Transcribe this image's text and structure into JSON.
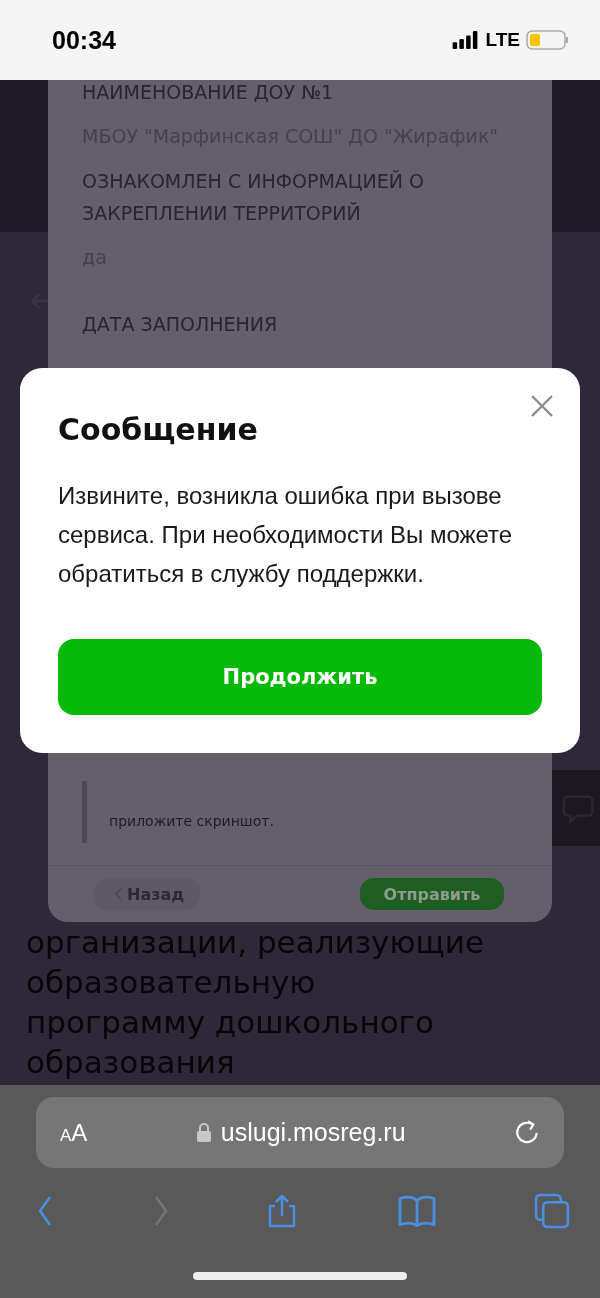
{
  "status_bar": {
    "time": "00:34",
    "network": "LTE"
  },
  "page": {
    "paragraph": "организации, реализующие образовательную программу дошкольного образования"
  },
  "sheet": {
    "fields": [
      {
        "label": "НАИМЕНОВАНИЕ ДОУ №1",
        "value": "МБОУ \"Марфинская СОШ\" ДО \"Жирафик\""
      },
      {
        "label": "ОЗНАКОМЛЕН С ИНФОРМАЦИЕЙ О ЗАКРЕПЛЕНИИ ТЕРРИТОРИЙ",
        "value": "да"
      },
      {
        "label": "ДАТА ЗАПОЛНЕНИЯ"
      }
    ],
    "note": "приложите скриншот.",
    "buttons": [
      {
        "label": "Назад",
        "kind": "secondary"
      },
      {
        "label": "Отправить",
        "kind": "primary"
      }
    ]
  },
  "dialog": {
    "title": "Сообщение",
    "message": "Извините, возникла ошибка при вызове сервиса. При необходимости Вы можете обратиться в службу поддержки.",
    "button": "Продолжить"
  },
  "browser": {
    "text_size": "AA",
    "url": "uslugi.mosreg.ru"
  }
}
